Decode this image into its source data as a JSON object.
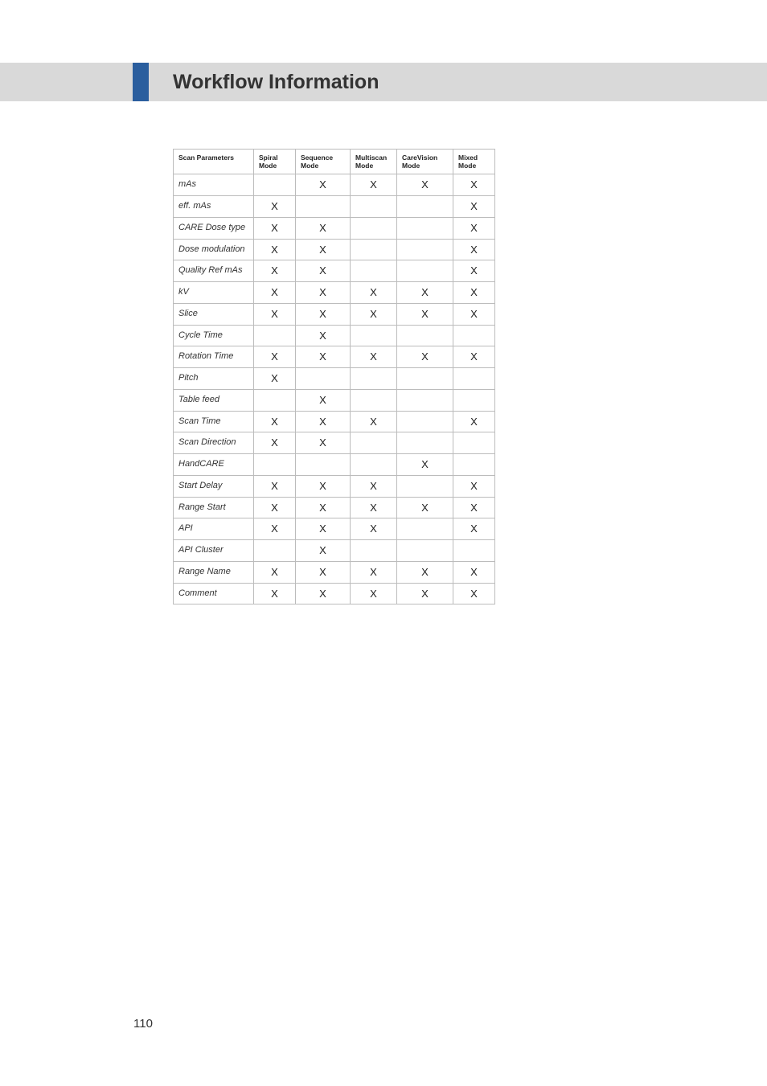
{
  "header": {
    "title": "Workflow Information"
  },
  "page_number": "110",
  "chart_data": {
    "type": "table",
    "columns": [
      "Scan Parameters",
      "Spiral Mode",
      "Sequence Mode",
      "Multiscan Mode",
      "CareVision Mode",
      "Mixed Mode"
    ],
    "rows": [
      {
        "param": "mAs",
        "values": [
          "",
          "X",
          "X",
          "X",
          "X"
        ]
      },
      {
        "param": "eff. mAs",
        "values": [
          "X",
          "",
          "",
          "",
          "X"
        ]
      },
      {
        "param": "CARE Dose type",
        "values": [
          "X",
          "X",
          "",
          "",
          "X"
        ]
      },
      {
        "param": "Dose modulation",
        "values": [
          "X",
          "X",
          "",
          "",
          "X"
        ]
      },
      {
        "param": "Quality Ref mAs",
        "values": [
          "X",
          "X",
          "",
          "",
          "X"
        ]
      },
      {
        "param": "kV",
        "values": [
          "X",
          "X",
          "X",
          "X",
          "X"
        ]
      },
      {
        "param": "Slice",
        "values": [
          "X",
          "X",
          "X",
          "X",
          "X"
        ]
      },
      {
        "param": "Cycle Time",
        "values": [
          "",
          "X",
          "",
          "",
          ""
        ]
      },
      {
        "param": "Rotation Time",
        "values": [
          "X",
          "X",
          "X",
          "X",
          "X"
        ]
      },
      {
        "param": "Pitch",
        "values": [
          "X",
          "",
          "",
          "",
          ""
        ]
      },
      {
        "param": "Table feed",
        "values": [
          "",
          "X",
          "",
          "",
          ""
        ]
      },
      {
        "param": "Scan Time",
        "values": [
          "X",
          "X",
          "X",
          "",
          "X"
        ]
      },
      {
        "param": "Scan Direction",
        "values": [
          "X",
          "X",
          "",
          "",
          ""
        ]
      },
      {
        "param": "HandCARE",
        "values": [
          "",
          "",
          "",
          "X",
          ""
        ]
      },
      {
        "param": "Start Delay",
        "values": [
          "X",
          "X",
          "X",
          "",
          "X"
        ]
      },
      {
        "param": "Range  Start",
        "values": [
          "X",
          "X",
          "X",
          "X",
          "X"
        ]
      },
      {
        "param": "API",
        "values": [
          "X",
          "X",
          "X",
          "",
          "X"
        ]
      },
      {
        "param": "API Cluster",
        "values": [
          "",
          "X",
          "",
          "",
          ""
        ]
      },
      {
        "param": "Range Name",
        "values": [
          "X",
          "X",
          "X",
          "X",
          "X"
        ]
      },
      {
        "param": "Comment",
        "values": [
          "X",
          "X",
          "X",
          "X",
          "X"
        ]
      }
    ]
  }
}
